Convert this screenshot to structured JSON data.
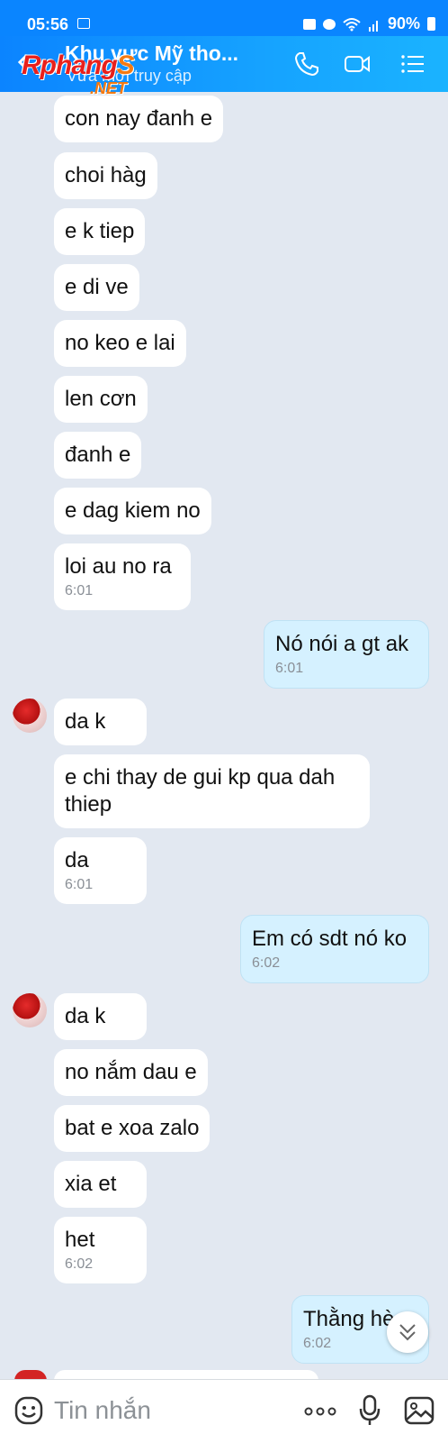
{
  "status_bar": {
    "time": "05:56",
    "battery": "90%"
  },
  "header": {
    "title": "Khu vực Mỹ tho...",
    "subtitle": "Vừa mới truy cập",
    "watermark_main": "Rphang",
    "watermark_s": "S",
    "watermark_net": ".NET"
  },
  "messages": {
    "m1": {
      "text": "con nay đanh e"
    },
    "m2": {
      "text": "choi hàg"
    },
    "m3": {
      "text": "e k tiep"
    },
    "m4": {
      "text": "e di ve"
    },
    "m5": {
      "text": "no keo e lai"
    },
    "m6": {
      "text": "len cơn"
    },
    "m7": {
      "text": "đanh e"
    },
    "m8": {
      "text": "e dag kiem no"
    },
    "m9": {
      "text": "loi au no ra",
      "time": "6:01"
    },
    "m10": {
      "text": "Nó nói a gt ak",
      "time": "6:01"
    },
    "m11": {
      "text": "da k"
    },
    "m12": {
      "text_line1": "e chi thay de gui kp qua dah",
      "text_line2": "thiep"
    },
    "m13": {
      "text": "da",
      "time": "6:01"
    },
    "m14": {
      "text": "Em có sdt nó ko",
      "time": "6:02"
    },
    "m15": {
      "text": "da k"
    },
    "m16": {
      "text": "no nắm dau e"
    },
    "m17": {
      "text": "bat e xoa zalo"
    },
    "m18": {
      "text": "xia et"
    },
    "m19": {
      "text": "het",
      "time": "6:02"
    },
    "m20": {
      "text": "Thằng hè",
      "time": "6:02"
    }
  },
  "input": {
    "placeholder": "Tin nhắn"
  },
  "colors": {
    "header": "#0b84ff",
    "sent_bubble": "#d5f1ff",
    "received_bubble": "#ffffff",
    "background": "#e2e8f1"
  }
}
